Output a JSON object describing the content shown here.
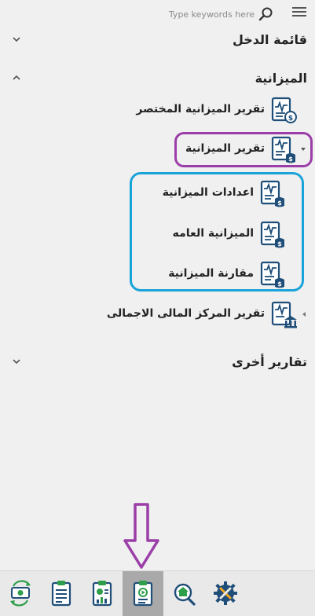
{
  "search": {
    "placeholder": "Type keywords here"
  },
  "nav": {
    "groups": [
      {
        "label": "قائمة الدخل",
        "expanded": false
      },
      {
        "label": "الميزانية",
        "expanded": true
      },
      {
        "label": "تقارير أخرى",
        "expanded": false
      }
    ],
    "items": [
      {
        "label": "تقرير الميزانية المختصر"
      },
      {
        "label": "تقرير الميزانية"
      },
      {
        "label": "اعدادات الميزانية"
      },
      {
        "label": "الميزانية العامه"
      },
      {
        "label": "مقارنة الميزانية"
      },
      {
        "label": "تقرير المركز المالى الاجمالى"
      }
    ]
  },
  "toolbar": {
    "buttons": [
      {
        "icon": "money-cycle-icon"
      },
      {
        "icon": "clipboard-list-icon"
      },
      {
        "icon": "clipboard-chart-icon"
      },
      {
        "icon": "clipboard-play-icon",
        "active": true
      },
      {
        "icon": "home-search-icon"
      },
      {
        "icon": "gear-tools-icon"
      }
    ]
  },
  "colors": {
    "highlight_purple": "#9b3ea8",
    "highlight_blue": "#1aa3d9",
    "icon_navy": "#1f4e79",
    "icon_green": "#2e9e4a"
  }
}
